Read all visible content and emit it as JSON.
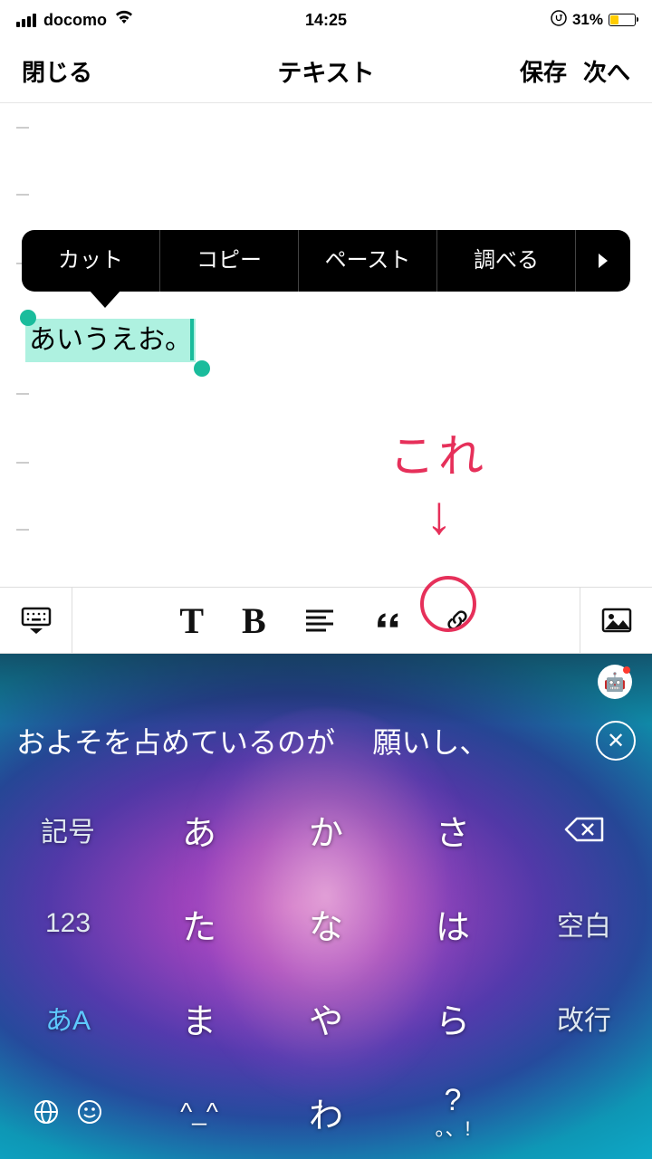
{
  "status": {
    "carrier": "docomo",
    "time": "14:25",
    "battery_pct": "31%"
  },
  "nav": {
    "close": "閉じる",
    "title": "テキスト",
    "save": "保存",
    "next": "次へ"
  },
  "context_menu": {
    "cut": "カット",
    "copy": "コピー",
    "paste": "ペースト",
    "lookup": "調べる"
  },
  "editor": {
    "selected_text": "あいうえお。"
  },
  "annotation": {
    "label": "これ"
  },
  "toolbar": {
    "text": "T",
    "bold": "B"
  },
  "keyboard": {
    "suggest1": "およそを占めているのが",
    "suggest2": "願いし、",
    "rows": {
      "r1": {
        "side_l": "記号",
        "c1": "あ",
        "c2": "か",
        "c3": "さ",
        "side_r": ""
      },
      "r2": {
        "side_l": "123",
        "c1": "た",
        "c2": "な",
        "c3": "は",
        "side_r": "空白"
      },
      "r3": {
        "side_l": "あA",
        "c1": "ま",
        "c2": "や",
        "c3": "ら",
        "side_r": "改行"
      },
      "r4": {
        "c1": "^_^",
        "c2": "わ",
        "c3_top": "?",
        "c3_bot": "。、!"
      }
    }
  }
}
